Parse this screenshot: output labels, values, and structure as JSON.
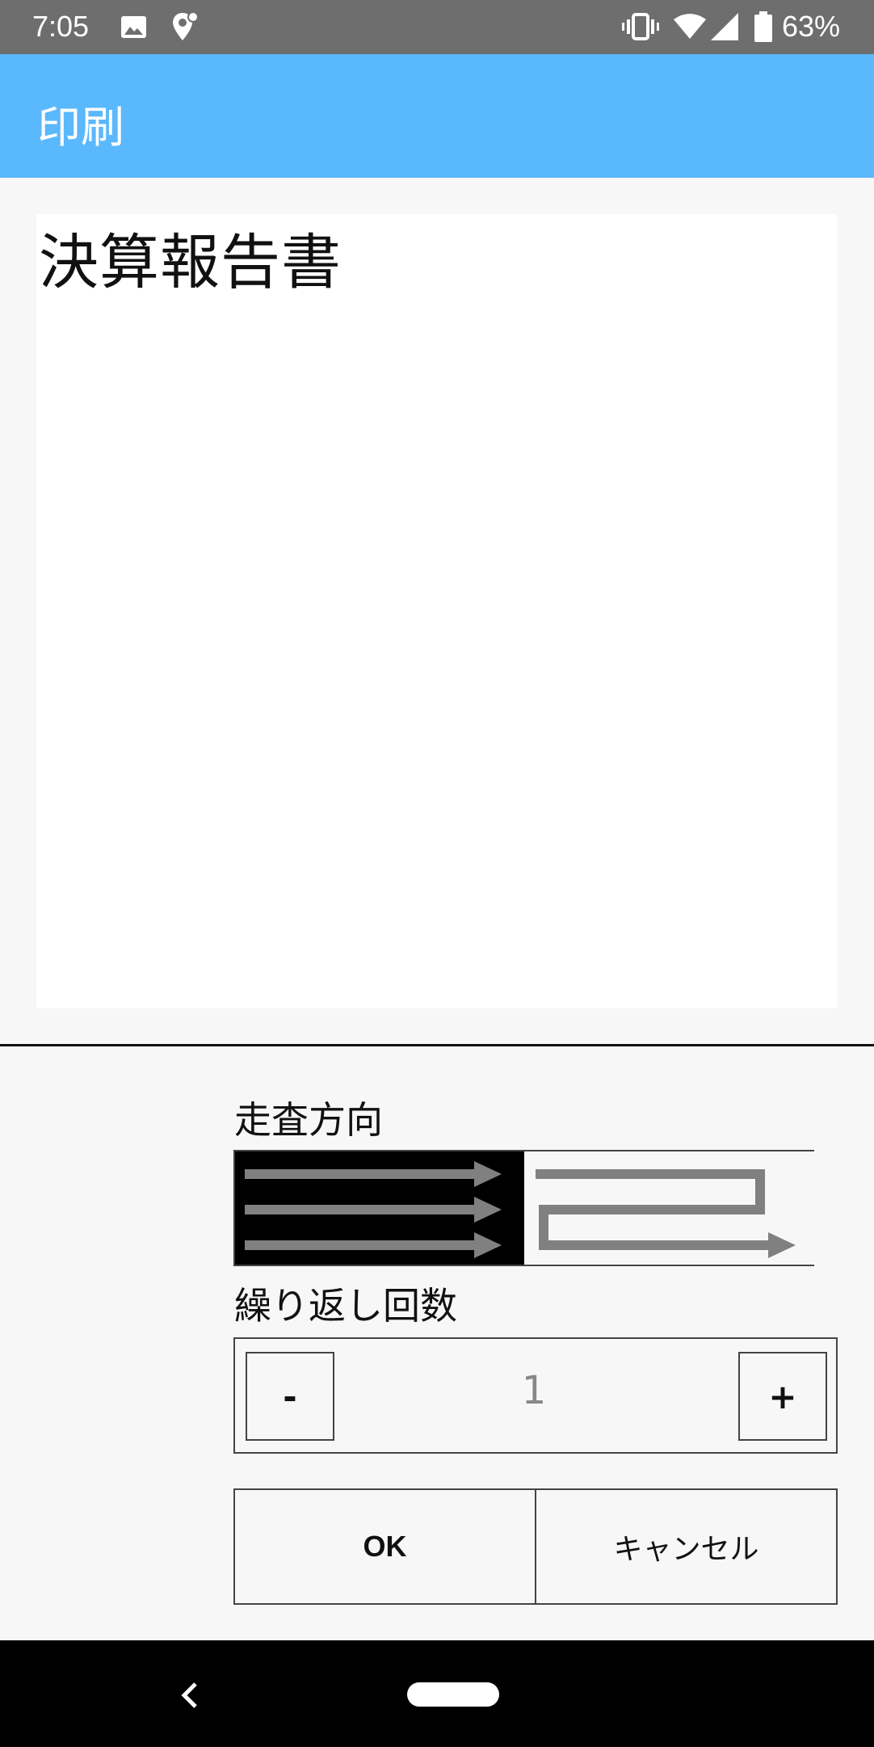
{
  "status_bar": {
    "time": "7:05",
    "battery": "63%",
    "icons": [
      "image-icon",
      "location-icon",
      "vibrate-icon",
      "wifi-icon",
      "signal-icon",
      "battery-icon"
    ]
  },
  "app_bar": {
    "title": "印刷"
  },
  "preview": {
    "text": "決算報告書"
  },
  "scan": {
    "label": "走査方向",
    "options": [
      {
        "name": "one-direction",
        "selected": true
      },
      {
        "name": "zigzag",
        "selected": false
      }
    ]
  },
  "repeat": {
    "label": "繰り返し回数",
    "minus_label": "-",
    "plus_label": "+",
    "value": "1"
  },
  "actions": {
    "ok_label": "OK",
    "cancel_label": "キャンセル"
  },
  "colors": {
    "app_bar": "#5ab8fd",
    "status_bar": "#6e6e6e",
    "arrow": "#808080"
  }
}
